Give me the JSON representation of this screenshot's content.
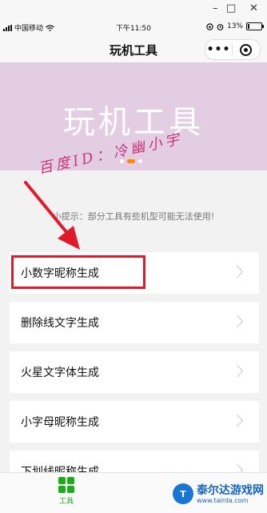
{
  "window": {
    "minimize": "–",
    "maximize": "□",
    "close": "✕"
  },
  "status_bar": {
    "carrier": "中国移动",
    "time": "下午11:50",
    "battery": "13%",
    "battery_level": 0.13
  },
  "nav": {
    "title": "玩机工具",
    "more": "•••"
  },
  "banner": {
    "title": "玩机工具",
    "watermark": "百度ID：冷幽小宇",
    "slides": 3,
    "active_slide": 1
  },
  "tip": "小提示：部分工具有些机型可能无法使用!",
  "tools": [
    {
      "label": "小数字昵称生成"
    },
    {
      "label": "删除线文字生成"
    },
    {
      "label": "火星文字体生成"
    },
    {
      "label": "小字母昵称生成"
    },
    {
      "label": "下划线昵称生成"
    }
  ],
  "tab_bar": {
    "tools_label": "工具"
  },
  "corner_logo": {
    "name": "泰尔达游戏网",
    "url": "www.tairda.com"
  },
  "colors": {
    "banner_bg": "#e3cde3",
    "highlight": "#e11a2b",
    "tab_active": "#1aad19",
    "watermark": "#c8357a"
  }
}
